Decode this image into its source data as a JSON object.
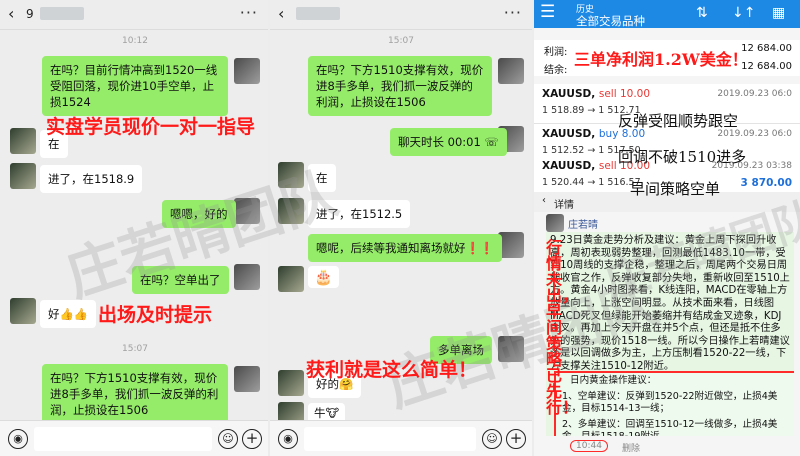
{
  "chat1": {
    "title": "9",
    "time1": "10:12",
    "msg_market": "在吗？目前行情冲高到1520一线受阻回落，现价进10手空单，止损1524",
    "msg_reply_in": "在",
    "msg_entered": "进了，在1518.9",
    "msg_ok": "嗯嗯，好的",
    "msg_profit": "在吗？空单出了",
    "msg_good": "好👍👍",
    "time2": "15:07",
    "msg_long": "在吗？下方1510支撑有效，现价进8手多单，我们抓一波反弹的利润，止损设在1506"
  },
  "chat2": {
    "time1": "15:07",
    "msg_long": "在吗？下方1510支撑有效，现价进8手多单，我们抓一波反弹的利润，止损设在1506",
    "call": "聊天时长 00:01 ☏",
    "msg_in": "在",
    "msg_entered": "进了，在1512.5",
    "msg_wait": "嗯呢，后续等我通知离场就好❗❗",
    "emoji": "🎂",
    "msg_exit": "多单离场",
    "msg_good": "好的🤗",
    "msg_niu": "牛🐮"
  },
  "trade": {
    "header_small": "历史",
    "header_big": "全部交易品种",
    "profit_label": "利润:",
    "profit_value": "12 684.00",
    "balance_label": "结余:",
    "balance_value": "12 684.00",
    "rows": [
      {
        "sym": "XAUUSD,",
        "dir": "sell 10.00",
        "px": "1 518.89 → 1 512.71",
        "dt": "2019.09.23 06:0",
        "pl": ""
      },
      {
        "sym": "XAUUSD,",
        "dir": "buy 8.00",
        "px": "1 512.52 → 1 517.50",
        "dt": "2019.09.23 06:0",
        "pl": ""
      },
      {
        "sym": "XAUUSD,",
        "dir": "sell 10.00",
        "px": "1 520.44 → 1 516.57",
        "dt": "2019.09.23 03:38",
        "pl": "3 870.00"
      }
    ],
    "detail_title": "详情",
    "author": "庄若晴",
    "analysis": "9.23日黄金走势分析及建议：黄金上周下探回升收高，周初表现弱势整理，回测最低1483.10一带，受到10周线的支撑企稳，整理之后，周尾两个交易日周线收官之作，反弹收复部分失地，重新收回至1510上方。黄金4小时图来看，K线连阳，MACD在零轴上方放量向上，上涨空间明显。从技术面来看，日线图MACD死叉但绿能开始萎缩并有结成金叉迹象，KDJ金叉。再加上今天开盘在并5个点，但还是抵不住多头的强势，现价1518一线。所以今日操作上若晴建议还是以回调做多为主，上方压制看1520-22一线，下方支撑关注1510-12附近。",
    "box_title": "日内黄金操作建议：",
    "box_line1": "1、空单建议：反弹到1520-22附近做空，止损4美金，目标1514-13一线；",
    "box_line2": "2、多单建议：回调至1510-12一线做多，止损4美金，目标1518-19附近。",
    "post_time": "10:44",
    "delete": "删除"
  },
  "annotations": {
    "coaching": "实盘学员现价一对一指导",
    "exit_prompt": "出场及时提示",
    "simple": "获利就是这么简单！",
    "net_profit": "三单净利润1.2W美金！",
    "follow_short": "反弹受阻顺势跟空",
    "pullback_long": "回调不破1510进多",
    "morning_short": "早间策略空单",
    "strategy_first": "行情未出，早间策略已先行！"
  },
  "watermark": "庄若晴团队",
  "colors": {
    "accent_red": "#ff1a1a",
    "wechat_green": "#95ec69",
    "mt4_blue": "#1e88e5"
  }
}
